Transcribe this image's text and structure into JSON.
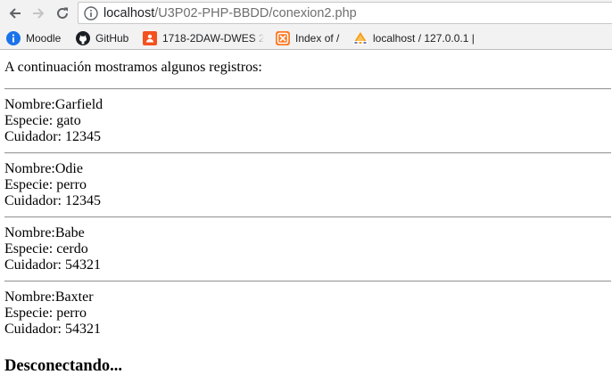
{
  "browser": {
    "url_host": "localhost",
    "url_path": "/U3P02-PHP-BBDD/conexion2.php",
    "bookmarks": [
      {
        "label": "Moodle",
        "icon": "info-icon"
      },
      {
        "label": "GitHub",
        "icon": "github-icon"
      },
      {
        "label": "1718-2DAW-DWES 2",
        "icon": "classroom-icon"
      },
      {
        "label": "Index of /",
        "icon": "xampp-icon"
      },
      {
        "label": "localhost / 127.0.0.1 |",
        "icon": "phpmyadmin-icon"
      }
    ]
  },
  "content": {
    "intro": "A continuación mostramos algunos registros:",
    "records": [
      {
        "nombre": "Nombre:Garfield",
        "especie": "Especie: gato",
        "cuidador": "Cuidador: 12345"
      },
      {
        "nombre": "Nombre:Odie",
        "especie": "Especie: perro",
        "cuidador": "Cuidador: 12345"
      },
      {
        "nombre": "Nombre:Babe",
        "especie": "Especie: cerdo",
        "cuidador": "Cuidador: 54321"
      },
      {
        "nombre": "Nombre:Baxter",
        "especie": "Especie: perro",
        "cuidador": "Cuidador: 54321"
      }
    ],
    "closing": "Desconectando..."
  },
  "colors": {
    "toolbar_bg": "#f2f2f2",
    "info_blue": "#1a73e8",
    "classroom_orange": "#f4511e",
    "xampp_orange": "#fb7a24"
  }
}
